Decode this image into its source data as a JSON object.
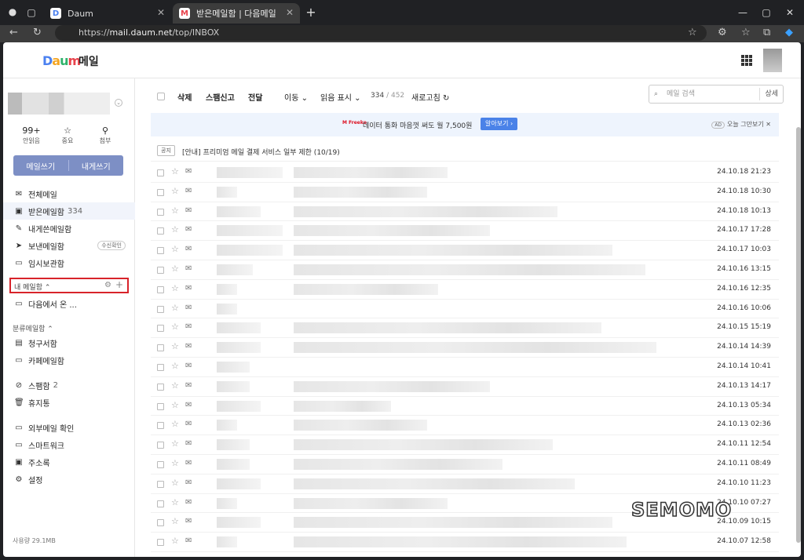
{
  "browser": {
    "tabs": [
      {
        "label": "Daum",
        "favicon": "D"
      },
      {
        "label": "받은메일함 | 다음메일",
        "favicon": "M"
      }
    ],
    "url_scheme": "https://",
    "url_host": "mail.daum.net",
    "url_path": "/top/INBOX"
  },
  "header": {
    "title": "메일"
  },
  "sidebar": {
    "stats": [
      {
        "value": "99+",
        "label": "안읽음"
      },
      {
        "value": "",
        "label": "중요"
      },
      {
        "value": "",
        "label": "첨부"
      }
    ],
    "compose": "메일쓰기",
    "compose_self": "내게쓰기",
    "folders": [
      {
        "label": "전체메일",
        "count": ""
      },
      {
        "label": "받은메일함",
        "count": "334"
      },
      {
        "label": "내게쓴메일함",
        "count": ""
      },
      {
        "label": "보낸메일함",
        "count": ""
      },
      {
        "label": "임시보관함",
        "count": ""
      }
    ],
    "sent_badge": "수신확인",
    "my_mailbox_label": "내 메일함",
    "my_folders": [
      {
        "label": "다음에서 온 ..."
      }
    ],
    "category_label": "분류메일함",
    "category_folders": [
      {
        "label": "청구서함"
      },
      {
        "label": "카페메일함"
      }
    ],
    "other_folders": [
      {
        "label": "스팸함",
        "count": "2"
      },
      {
        "label": "휴지통",
        "count": ""
      }
    ],
    "tools": [
      {
        "label": "외부메일 확인"
      },
      {
        "label": "스마트워크"
      },
      {
        "label": "주소록"
      },
      {
        "label": "설정"
      }
    ],
    "usage": "사용량 29.1MB"
  },
  "toolbar": {
    "delete": "삭제",
    "spam": "스팸신고",
    "forward": "전달",
    "move": "이동",
    "read_mark": "읽음 표시",
    "count": "334",
    "total": "452",
    "refresh": "새로고침",
    "search_placeholder": "메일 검색",
    "detail": "상세"
  },
  "ad": {
    "logo": "M Freeko",
    "text": "데이터 통화 마음껏 써도 월 7,500원",
    "button": "알아보기",
    "tag": "AD",
    "close": "오늘 그만보기"
  },
  "notice": {
    "tag": "공지",
    "text": "[안내] 프리미엄 메일 결제 서비스 일부 제한 (10/19)"
  },
  "mails": [
    {
      "date": "24.10.18 21:23"
    },
    {
      "date": "24.10.18 10:30"
    },
    {
      "date": "24.10.18 10:13"
    },
    {
      "date": "24.10.17 17:28"
    },
    {
      "date": "24.10.17 10:03"
    },
    {
      "date": "24.10.16 13:15"
    },
    {
      "date": "24.10.16 12:35"
    },
    {
      "date": "24.10.16 10:06"
    },
    {
      "date": "24.10.15 15:19"
    },
    {
      "date": "24.10.14 14:39"
    },
    {
      "date": "24.10.14 10:41"
    },
    {
      "date": "24.10.13 14:17"
    },
    {
      "date": "24.10.13 05:34"
    },
    {
      "date": "24.10.13 02:36"
    },
    {
      "date": "24.10.11 12:54"
    },
    {
      "date": "24.10.11 08:49"
    },
    {
      "date": "24.10.10 11:23"
    },
    {
      "date": "24.10.10 07:27"
    },
    {
      "date": "24.10.09 10:15"
    },
    {
      "date": "24.10.07 12:58"
    }
  ],
  "watermark": "SEMOMO"
}
